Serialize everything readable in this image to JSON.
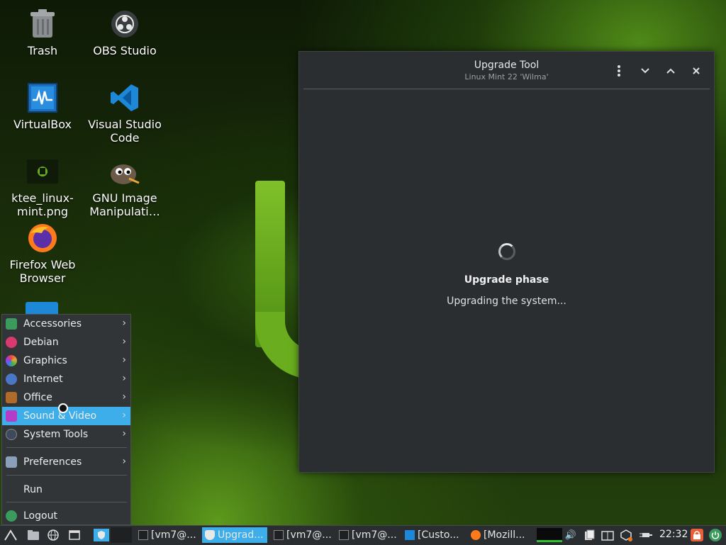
{
  "desktop": {
    "icons": [
      {
        "label": "Trash",
        "icon": "trash-icon"
      },
      {
        "label": "OBS Studio",
        "icon": "obs-icon"
      },
      {
        "label": "VirtualBox",
        "icon": "virtualbox-icon"
      },
      {
        "label": "Visual Studio Code",
        "icon": "vscode-icon"
      },
      {
        "label": "ktee_linux-mint.png",
        "icon": "image-file-icon"
      },
      {
        "label": "GNU Image Manipulati…",
        "icon": "gimp-icon"
      },
      {
        "label": "Firefox Web Browser",
        "icon": "firefox-icon"
      }
    ]
  },
  "window": {
    "title": "Upgrade Tool",
    "subtitle": "Linux Mint 22 'Wilma'",
    "phase": "Upgrade phase",
    "status": "Upgrading the system..."
  },
  "menu": {
    "categories": [
      {
        "label": "Accessories",
        "color": "#3a9b5c"
      },
      {
        "label": "Debian",
        "color": "#d63a6f"
      },
      {
        "label": "Graphics",
        "color": "#e8a33a"
      },
      {
        "label": "Internet",
        "color": "#4a78c8"
      },
      {
        "label": "Office",
        "color": "#b06a2a"
      },
      {
        "label": "Sound & Video",
        "color": "#b43cc8"
      },
      {
        "label": "System Tools",
        "color": "#3c4a5c"
      }
    ],
    "active": "Sound & Video",
    "preferences": "Preferences",
    "run": "Run",
    "logout": "Logout"
  },
  "taskbar": {
    "tasks": [
      {
        "label": "[vm7@...",
        "icon": "terminal-icon"
      },
      {
        "label": "Upgrad...",
        "icon": "shield-icon",
        "active": true
      },
      {
        "label": "[vm7@...",
        "icon": "terminal-icon"
      },
      {
        "label": "[vm7@...",
        "icon": "terminal-icon"
      },
      {
        "label": "[Custo...",
        "icon": "window-icon"
      },
      {
        "label": "[Mozill...",
        "icon": "firefox-icon"
      }
    ],
    "clock": "22:32"
  },
  "colors": {
    "accent": "#3daee9",
    "window_bg": "#2b2e30",
    "panel_bg": "#2b2e30"
  }
}
